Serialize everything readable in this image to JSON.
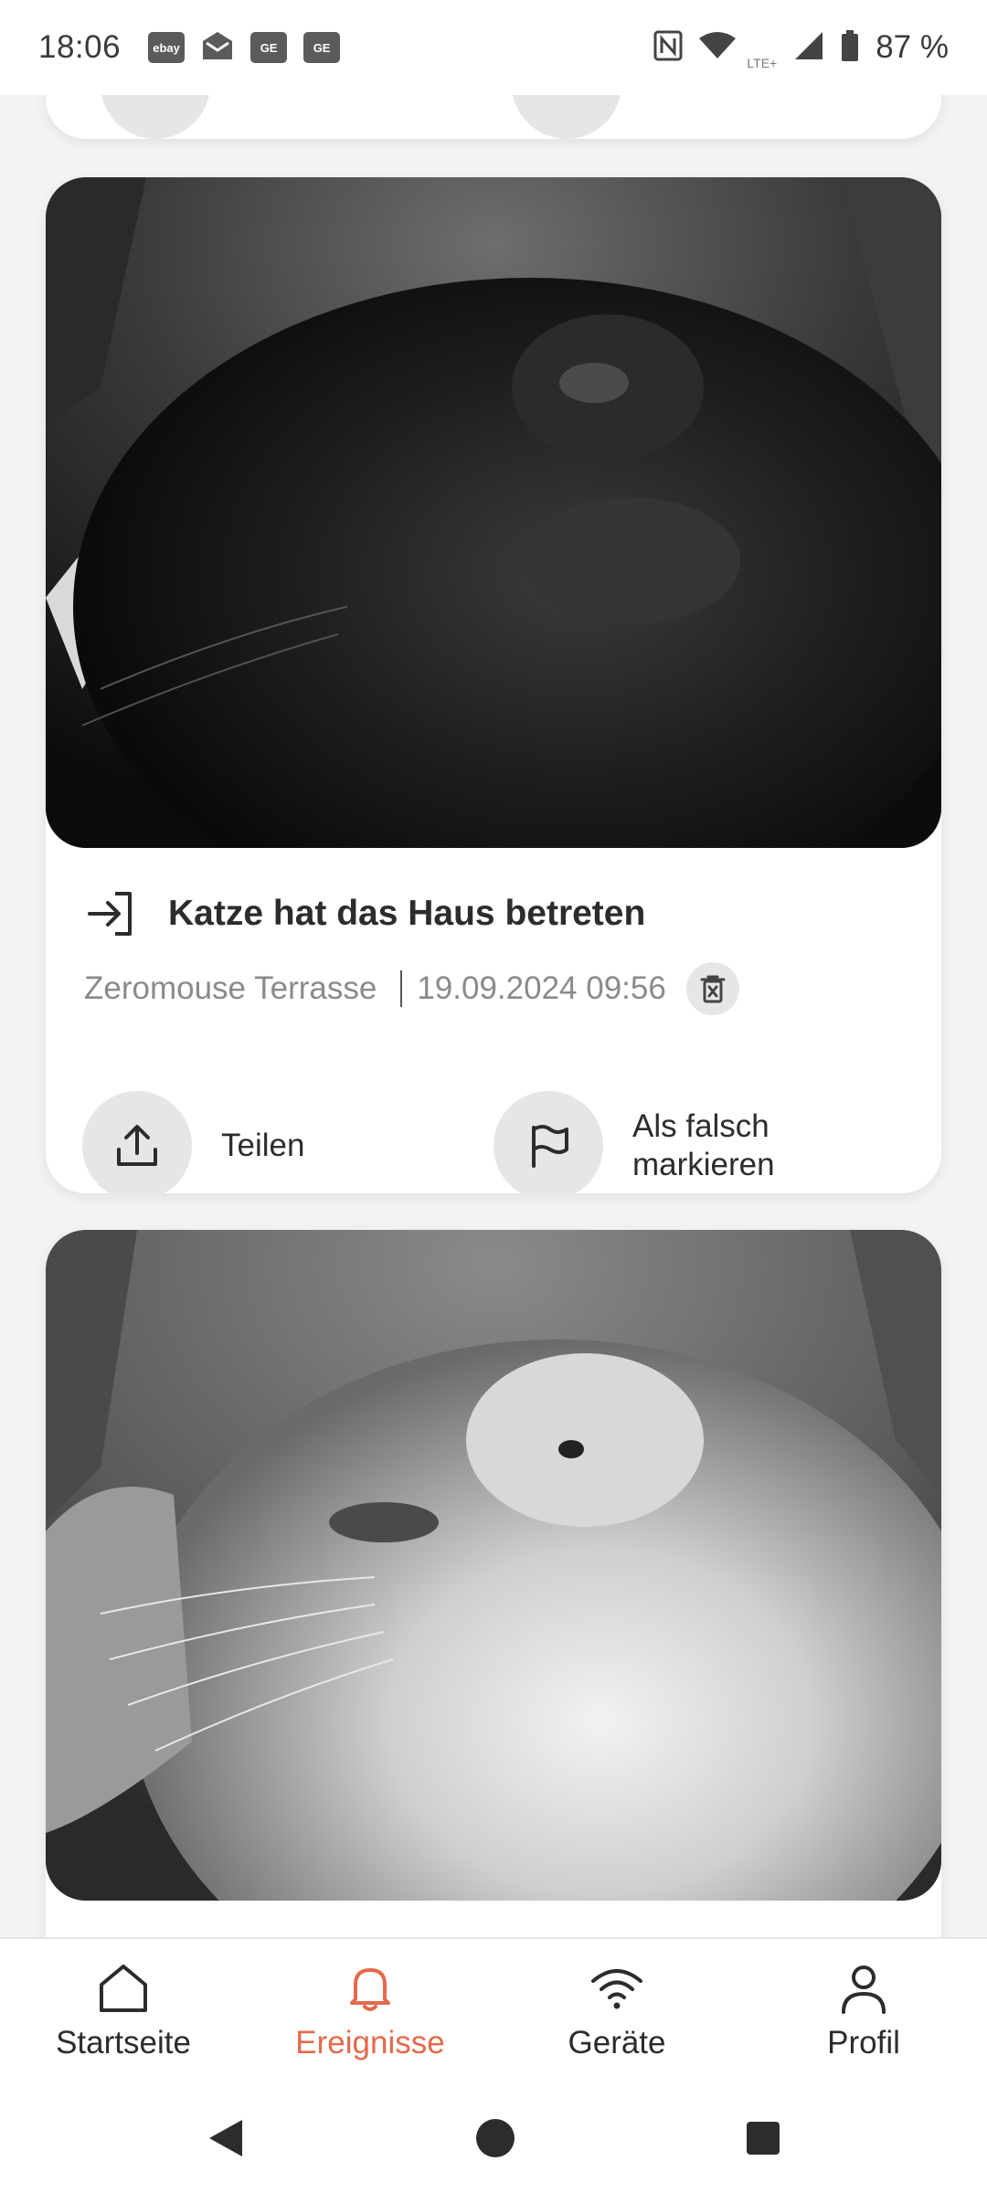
{
  "status_bar": {
    "time": "18:06",
    "notifications": [
      "ebay",
      "mail",
      "GE",
      "GE"
    ],
    "battery_text": "87 %",
    "network_label": "LTE+"
  },
  "events": [
    {
      "title": "Katze hat das Haus betreten",
      "device": "Zeromouse Terrasse",
      "datetime": "19.09.2024 09:56",
      "share_label": "Teilen",
      "flag_label_line1": "Als falsch",
      "flag_label_line2": "markieren"
    }
  ],
  "bottom_nav": {
    "items": [
      {
        "label": "Startseite",
        "icon": "home-icon"
      },
      {
        "label": "Ereignisse",
        "icon": "bell-icon"
      },
      {
        "label": "Geräte",
        "icon": "wifi-icon"
      },
      {
        "label": "Profil",
        "icon": "person-icon"
      }
    ],
    "active_index": 1,
    "active_color": "#e36a4c"
  }
}
